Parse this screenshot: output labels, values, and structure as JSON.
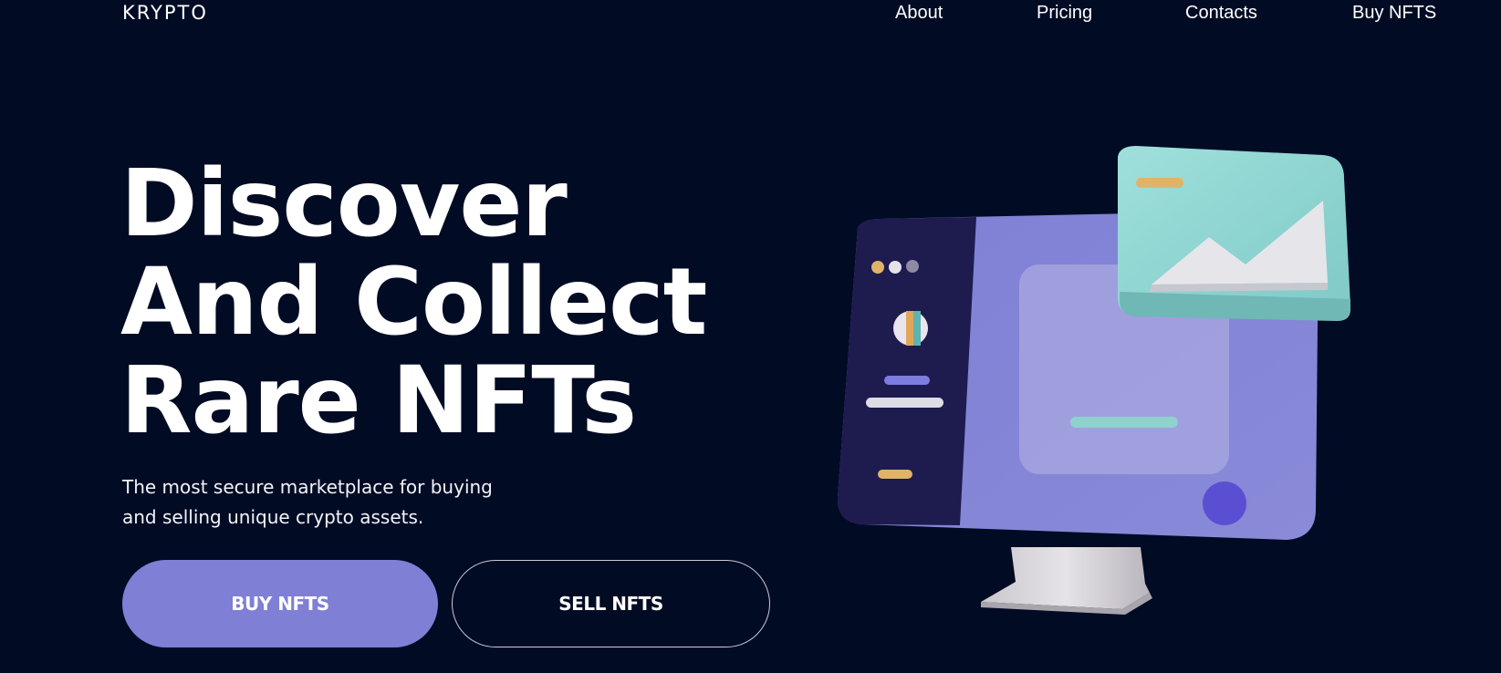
{
  "header": {
    "logo": "KRYPTO",
    "nav": [
      {
        "label": "About"
      },
      {
        "label": "Pricing"
      },
      {
        "label": "Contacts"
      },
      {
        "label": "Buy NFTS"
      }
    ]
  },
  "hero": {
    "title_lines": [
      "Discover",
      "And Collect",
      "Rare NFTs"
    ],
    "subtitle": "The most secure marketplace for buying and selling unique crypto assets.",
    "buttons": {
      "buy_label": "BUY NFTS",
      "sell_label": "SELL NFTS"
    }
  },
  "colors": {
    "background": "#020b24",
    "accent": "#7f7fd6",
    "text": "#ffffff"
  },
  "icons": [
    "nft-monitor-illustration",
    "image-card-icon"
  ]
}
